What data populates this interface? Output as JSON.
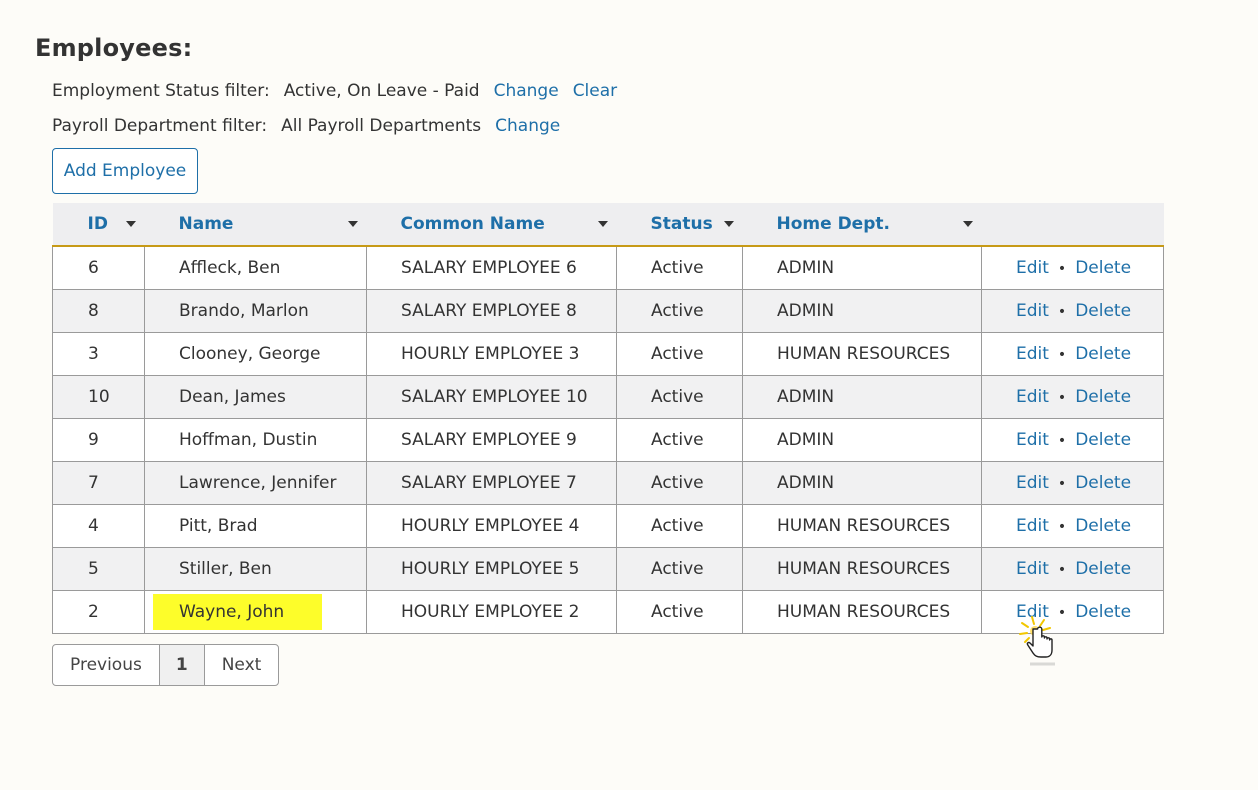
{
  "page": {
    "title": "Employees:"
  },
  "filters": {
    "status": {
      "label": "Employment Status filter:",
      "value": "Active, On Leave - Paid",
      "change": "Change",
      "clear": "Clear"
    },
    "payroll": {
      "label": "Payroll Department filter:",
      "value": "All Payroll Departments",
      "change": "Change"
    }
  },
  "toolbar": {
    "add_label": "Add Employee"
  },
  "table": {
    "headers": {
      "id": "ID",
      "name": "Name",
      "common": "Common Name",
      "status": "Status",
      "dept": "Home Dept."
    },
    "actions": {
      "edit": "Edit",
      "sep": "•",
      "delete": "Delete"
    },
    "rows": [
      {
        "id": "6",
        "name": "Affleck, Ben",
        "common": "SALARY EMPLOYEE 6",
        "status": "Active",
        "dept": "ADMIN"
      },
      {
        "id": "8",
        "name": "Brando, Marlon",
        "common": "SALARY EMPLOYEE 8",
        "status": "Active",
        "dept": "ADMIN"
      },
      {
        "id": "3",
        "name": "Clooney, George",
        "common": "HOURLY EMPLOYEE 3",
        "status": "Active",
        "dept": "HUMAN RESOURCES"
      },
      {
        "id": "10",
        "name": "Dean, James",
        "common": "SALARY EMPLOYEE 10",
        "status": "Active",
        "dept": "ADMIN"
      },
      {
        "id": "9",
        "name": "Hoffman, Dustin",
        "common": "SALARY EMPLOYEE 9",
        "status": "Active",
        "dept": "ADMIN"
      },
      {
        "id": "7",
        "name": "Lawrence, Jennifer",
        "common": "SALARY EMPLOYEE 7",
        "status": "Active",
        "dept": "ADMIN"
      },
      {
        "id": "4",
        "name": "Pitt, Brad",
        "common": "HOURLY EMPLOYEE 4",
        "status": "Active",
        "dept": "HUMAN RESOURCES"
      },
      {
        "id": "5",
        "name": "Stiller, Ben",
        "common": "HOURLY EMPLOYEE 5",
        "status": "Active",
        "dept": "HUMAN RESOURCES"
      },
      {
        "id": "2",
        "name": "Wayne, John",
        "common": "HOURLY EMPLOYEE 2",
        "status": "Active",
        "dept": "HUMAN RESOURCES",
        "highlighted": true
      }
    ]
  },
  "pagination": {
    "previous": "Previous",
    "current": "1",
    "next": "Next"
  },
  "colors": {
    "link": "#1e6fa8",
    "header_rule": "#c79a16",
    "highlight": "#fdfd2a"
  },
  "cursor": {
    "icon": "hand-pointer-click-icon"
  }
}
